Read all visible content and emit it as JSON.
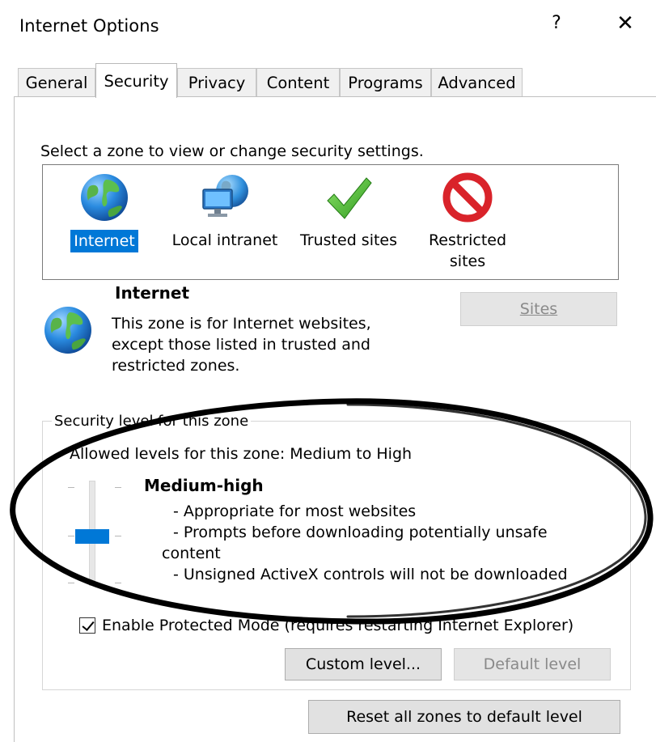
{
  "window": {
    "title": "Internet Options",
    "help": "?",
    "close": "✕"
  },
  "tabs": [
    {
      "label": "General"
    },
    {
      "label": "Security"
    },
    {
      "label": "Privacy"
    },
    {
      "label": "Content"
    },
    {
      "label": "Programs"
    },
    {
      "label": "Advanced"
    }
  ],
  "zones": {
    "prompt": "Select a zone to view or change security settings.",
    "items": [
      {
        "label": "Internet",
        "icon": "globe-icon"
      },
      {
        "label": "Local intranet",
        "icon": "network-globe-icon"
      },
      {
        "label": "Trusted sites",
        "icon": "checkmark-icon"
      },
      {
        "label": "Restricted sites",
        "icon": "blocked-icon"
      }
    ]
  },
  "zone_info": {
    "title": "Internet",
    "desc_lines": [
      "This zone is for Internet websites,",
      "except those listed in trusted and",
      "restricted zones."
    ],
    "sites_button": "Sites"
  },
  "security_level": {
    "legend": "Security level for this zone",
    "allowed": "Allowed levels for this zone: Medium to High",
    "level_fraction": 0.5,
    "level_name": "Medium-high",
    "desc_lines": [
      "- Appropriate for most websites",
      "- Prompts before downloading potentially unsafe",
      "content",
      "- Unsigned ActiveX controls will not be downloaded"
    ],
    "protected_mode_label": "Enable Protected Mode (requires restarting Internet Explorer)",
    "protected_mode_checked": true,
    "custom_button": "Custom level...",
    "default_button": "Default level"
  },
  "reset_button": "Reset all zones to default level",
  "colors": {
    "accent": "#0078d7",
    "annotation": "#000000"
  }
}
